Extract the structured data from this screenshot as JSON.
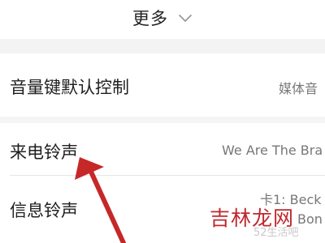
{
  "header": {
    "more_label": "更多",
    "more_icon": "chevron-down-icon"
  },
  "settings": {
    "volume_key": {
      "label": "音量键默认控制",
      "value": "媒体音"
    },
    "call_ringtone": {
      "label": "来电铃声",
      "value": "We Are The Bra"
    },
    "message_ringtone": {
      "label": "信息铃声",
      "value_sim1": "卡1: Beck",
      "value_sim2": "Bon"
    }
  },
  "annotation": {
    "arrow_color": "#c62828"
  },
  "watermark": {
    "logo": "吉林龙网",
    "url": "52生活吧"
  }
}
